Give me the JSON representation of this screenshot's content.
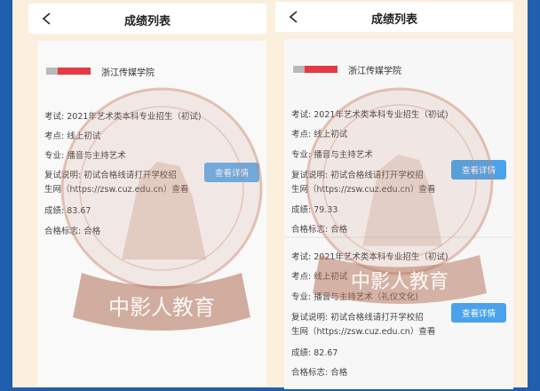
{
  "nav_title": "成绩列表",
  "school": "浙江传媒学院",
  "labels": {
    "exam": "考试:",
    "venue": "考点:",
    "major": "专业:",
    "note": "复试说明:",
    "score": "成绩:",
    "pass": "合格标志:"
  },
  "detail_button": "查看详情",
  "watermark_text": "中影人教育",
  "colors": {
    "accent": "#4aa3ea",
    "frame": "#1f5fae",
    "background": "#fbefdd"
  },
  "left_record": {
    "exam": "2021年艺术类本科专业招生（初试)",
    "venue": "线上初试",
    "major": "播音与主持艺术",
    "note_line1": "初试合格线请打开学校招",
    "note_line2": "生网（https://zsw.cuz.edu.cn）查看",
    "score": "83.67",
    "pass": "合格"
  },
  "right_records": [
    {
      "exam": "2021年艺术类本科专业招生（初试)",
      "venue": "线上初试",
      "major": "播音与主持艺术",
      "note_line1": "初试合格线请打开学校招",
      "note_line2": "生网（https://zsw.cuz.edu.cn）查看",
      "score": "79.33",
      "pass": "合格"
    },
    {
      "exam": "2021年艺术类本科专业招生（初试)",
      "venue": "线上初试",
      "major": "播音与主持艺术（礼仪文化)",
      "note_line1": "初试合格线请打开学校招",
      "note_line2": "生网（https://zsw.cuz.edu.cn）查看",
      "score": "82.67",
      "pass": "合格"
    }
  ]
}
